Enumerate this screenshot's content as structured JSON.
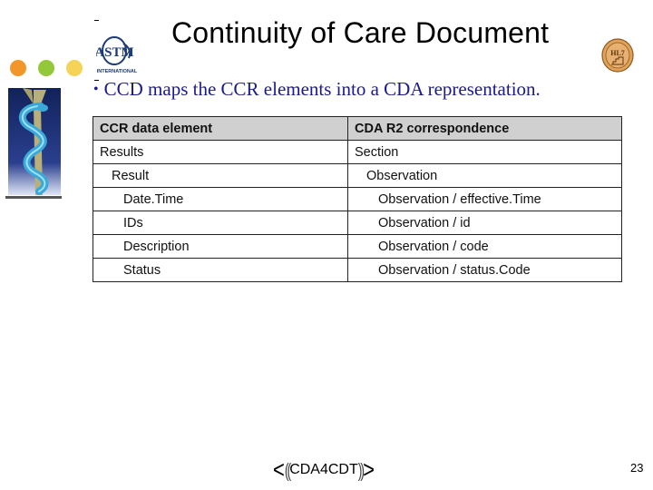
{
  "slide": {
    "title": "Continuity of Care Document",
    "bullet": "CCD maps the CCR elements into a CDA representation.",
    "bullet_marker": "•",
    "page_number": "23",
    "logos": {
      "left_top": "ASTM International",
      "right_top": "HL7",
      "left_image": "caduceus-snake-staff",
      "footer": {
        "left_bracket": "<",
        "left_waves": "((",
        "text": "CDA4CDT",
        "right_waves": "))",
        "right_bracket": ">"
      }
    },
    "decor_dot_colors": [
      "#f2962a",
      "#92c83a",
      "#f5d356"
    ]
  },
  "table": {
    "headers": [
      "CCR data element",
      "CDA R2 correspondence"
    ],
    "rows": [
      {
        "ccr": "Results",
        "cda": "Section",
        "level": 0
      },
      {
        "ccr": "Result",
        "cda": "Observation",
        "level": 1
      },
      {
        "ccr": "Date.Time",
        "cda": "Observation / effective.Time",
        "level": 2
      },
      {
        "ccr": "IDs",
        "cda": "Observation / id",
        "level": 2
      },
      {
        "ccr": "Description",
        "cda": "Observation / code",
        "level": 2
      },
      {
        "ccr": "Status",
        "cda": "Observation / status.Code",
        "level": 2
      }
    ]
  },
  "colors": {
    "bullet_text": "#1a1a8c",
    "header_bg": "#d0d0d0"
  }
}
